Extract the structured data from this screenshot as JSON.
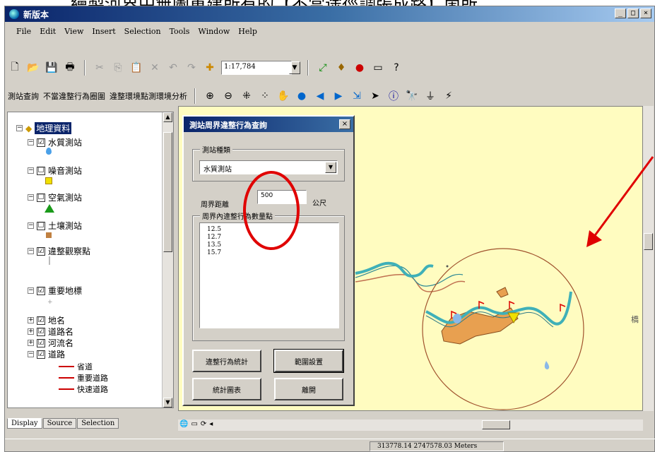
{
  "caption": "繪製河界中無圖重建所有的【不當途徑調張成路】箇所。",
  "window": {
    "title": "新版本",
    "controls": [
      "_",
      "□",
      "×"
    ]
  },
  "menu": [
    "File",
    "Edit",
    "View",
    "Insert",
    "Selection",
    "Tools",
    "Window",
    "Help"
  ],
  "toolbar": {
    "scale": "1:17,784"
  },
  "custom_toolbar": [
    "測站查詢",
    "不當違整行為圈圍",
    "違整環境點測環境分析"
  ],
  "toc": {
    "items": [
      {
        "label": "地理資料",
        "checked": ""
      },
      {
        "label": "水質測站",
        "checked": "☑"
      },
      {
        "label": "噪音測站",
        "checked": "☐"
      },
      {
        "label": "空氣測站",
        "checked": "☐"
      },
      {
        "label": "土壤測站",
        "checked": "☐"
      },
      {
        "label": "違整觀察點",
        "checked": "☑"
      },
      {
        "label": "重要地標",
        "checked": "☑"
      },
      {
        "label": "地名",
        "checked": "☑"
      },
      {
        "label": "道路名",
        "checked": "☑"
      },
      {
        "label": "河流名",
        "checked": "☑"
      },
      {
        "label": "道路",
        "checked": "☑"
      }
    ],
    "road_legend": [
      "省道",
      "重要道路",
      "快速道路"
    ],
    "tabs": [
      "Display",
      "Source",
      "Selection"
    ]
  },
  "dialog": {
    "title": "測站周界違整行為查詢",
    "group1_label": "測站種類",
    "station_type": "水質測站",
    "radius_label": "周界距離",
    "radius_value": "500",
    "radius_unit": "公尺",
    "group2_label": "周界內違整行為數量點",
    "results": [
      "12.5",
      "12.7",
      "13.5",
      "15.7"
    ],
    "buttons": [
      "違整行為統計",
      "範圍設置",
      "統計圖表",
      "離開"
    ]
  },
  "map": {
    "side_label": "橋"
  },
  "statusbar": {
    "coords": "313778.14  2747578.03 Meters"
  },
  "colors": {
    "map_bg": "#fffcc0",
    "river": "#3fb0b8",
    "annotation_red": "#e00000",
    "buffer_circle": "#a0522d",
    "parcel": "#e8a050"
  }
}
